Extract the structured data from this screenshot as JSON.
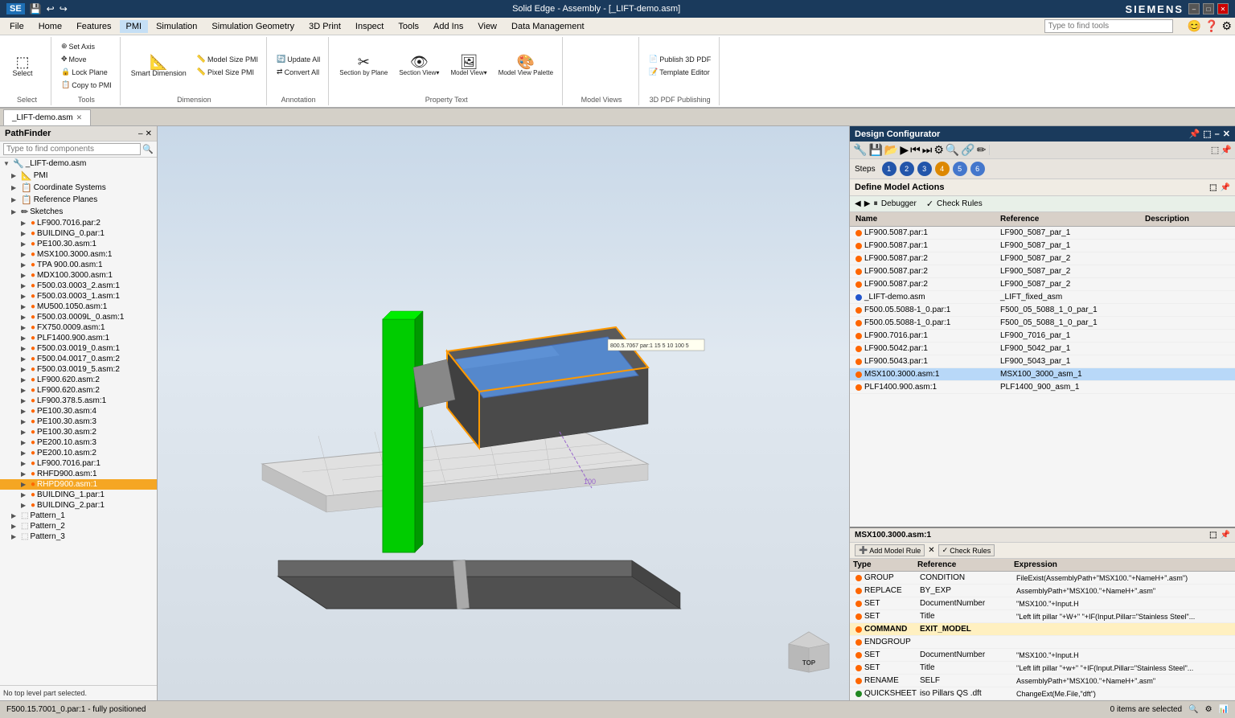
{
  "app": {
    "title": "Solid Edge - Assembly - [_LIFT-demo.asm]",
    "brand": "SIEMENS"
  },
  "titlebar": {
    "logo": "SE",
    "title": "Solid Edge - Assembly - [_LIFT-demo.asm]",
    "brand": "SIEMENS",
    "min_btn": "–",
    "max_btn": "□",
    "close_btn": "✕"
  },
  "menubar": {
    "items": [
      "File",
      "Home",
      "Features",
      "PMI",
      "Simulation",
      "Simulation Geometry",
      "3D Print",
      "Inspect",
      "Tools",
      "Add Ins",
      "View",
      "Data Management"
    ]
  },
  "ribbon": {
    "active_tab": "PMI",
    "search_placeholder": "Type to find tools",
    "groups": [
      {
        "label": "Select",
        "buttons": [
          {
            "label": "Select",
            "icon": "⬚"
          }
        ]
      },
      {
        "label": "Tools",
        "buttons": [
          {
            "label": "Set Axis",
            "icon": "⊕"
          },
          {
            "label": "Move",
            "icon": "✥"
          },
          {
            "label": "Lock Plane",
            "icon": "🔒"
          },
          {
            "label": "Copy to PMI",
            "icon": "📋"
          }
        ]
      },
      {
        "label": "Dimension",
        "buttons": [
          {
            "label": "Smart Dimension",
            "icon": "↔"
          },
          {
            "label": "Model Size PMI",
            "icon": "📐"
          },
          {
            "label": "Pixel Size PMI",
            "icon": "📏"
          }
        ]
      },
      {
        "label": "Annotation",
        "buttons": [
          {
            "label": "Update All",
            "icon": "🔄"
          },
          {
            "label": "Convert All",
            "icon": "⇄"
          }
        ]
      },
      {
        "label": "Property Text",
        "buttons": [
          {
            "label": "Section by Plane",
            "icon": "✂"
          },
          {
            "label": "Section View▾",
            "icon": "👁"
          },
          {
            "label": "Model View▾",
            "icon": "🖼"
          },
          {
            "label": "Model View Palette",
            "icon": "🎨"
          }
        ]
      },
      {
        "label": "Model Views",
        "buttons": []
      },
      {
        "label": "3D PDF Publishing",
        "buttons": [
          {
            "label": "Publish 3D PDF",
            "icon": "📄"
          },
          {
            "label": "Template Editor",
            "icon": "📝"
          }
        ]
      }
    ]
  },
  "tabbar": {
    "tabs": [
      {
        "label": "_LIFT-demo.asm",
        "active": true,
        "closeable": true
      }
    ]
  },
  "pathfinder": {
    "title": "PathFinder",
    "search_placeholder": "Type to find components",
    "tree": [
      {
        "level": 0,
        "expanded": true,
        "icon": "🔧",
        "label": "_LIFT-demo.asm",
        "type": "asm"
      },
      {
        "level": 1,
        "expanded": false,
        "icon": "📐",
        "label": "PMI",
        "type": "pmi"
      },
      {
        "level": 1,
        "expanded": false,
        "icon": "📋",
        "label": "Coordinate Systems",
        "type": "coord"
      },
      {
        "level": 1,
        "expanded": false,
        "icon": "📋",
        "label": "Reference Planes",
        "type": "ref"
      },
      {
        "level": 1,
        "expanded": false,
        "icon": "✏",
        "label": "Sketches",
        "type": "sketch"
      },
      {
        "level": 2,
        "expanded": false,
        "icon": "🟠",
        "label": "LF900.7016.par:2",
        "type": "part"
      },
      {
        "level": 2,
        "expanded": false,
        "icon": "🟠",
        "label": "BUILDING_0.par:1",
        "type": "part"
      },
      {
        "level": 2,
        "expanded": false,
        "icon": "🟠",
        "label": "PE100.30.asm:1",
        "type": "asm"
      },
      {
        "level": 2,
        "expanded": false,
        "icon": "🟠",
        "label": "MSX100.3000.asm:1",
        "type": "asm"
      },
      {
        "level": 2,
        "expanded": false,
        "icon": "🟠",
        "label": "TPA 900.00.asm:1",
        "type": "asm"
      },
      {
        "level": 2,
        "expanded": false,
        "icon": "🟠",
        "label": "MDX100.3000.asm:1",
        "type": "asm"
      },
      {
        "level": 2,
        "expanded": false,
        "icon": "🟠",
        "label": "F500.03.0003_2.asm:1",
        "type": "asm"
      },
      {
        "level": 2,
        "expanded": false,
        "icon": "🟠",
        "label": "F500.03.0003_1.asm:1",
        "type": "asm"
      },
      {
        "level": 2,
        "expanded": false,
        "icon": "🟠",
        "label": "MU500.1050.asm:1",
        "type": "asm"
      },
      {
        "level": 2,
        "expanded": false,
        "icon": "🟠",
        "label": "F500.03.0009L_0.asm:1",
        "type": "asm"
      },
      {
        "level": 2,
        "expanded": false,
        "icon": "🟠",
        "label": "FX750.0009.asm:1",
        "type": "asm"
      },
      {
        "level": 2,
        "expanded": false,
        "icon": "🟠",
        "label": "PLF1400.900.asm:1",
        "type": "asm"
      },
      {
        "level": 2,
        "expanded": false,
        "icon": "🟠",
        "label": "F500.03.0019_0.asm:1",
        "type": "asm"
      },
      {
        "level": 2,
        "expanded": false,
        "icon": "🟠",
        "label": "F500.04.0017_0.asm:2",
        "type": "asm"
      },
      {
        "level": 2,
        "expanded": false,
        "icon": "🟠",
        "label": "F500.03.0019_5.asm:2",
        "type": "asm"
      },
      {
        "level": 2,
        "expanded": false,
        "icon": "🟠",
        "label": "LF900.620.asm:2",
        "type": "asm"
      },
      {
        "level": 2,
        "expanded": false,
        "icon": "🟠",
        "label": "LF900.620.asm:2",
        "type": "asm"
      },
      {
        "level": 2,
        "expanded": false,
        "icon": "🟠",
        "label": "LF900.378.5.asm:1",
        "type": "asm"
      },
      {
        "level": 2,
        "expanded": false,
        "icon": "🟠",
        "label": "PE100.30.asm:4",
        "type": "asm"
      },
      {
        "level": 2,
        "expanded": false,
        "icon": "🟠",
        "label": "PE100.30.asm:3",
        "type": "asm"
      },
      {
        "level": 2,
        "expanded": false,
        "icon": "🟠",
        "label": "PE100.30.asm:2",
        "type": "asm"
      },
      {
        "level": 2,
        "expanded": false,
        "icon": "🟠",
        "label": "PE200.10.asm:3",
        "type": "asm"
      },
      {
        "level": 2,
        "expanded": false,
        "icon": "🟠",
        "label": "PE200.10.asm:2",
        "type": "asm"
      },
      {
        "level": 2,
        "expanded": false,
        "icon": "🟠",
        "label": "LF900.7016.par:1",
        "type": "part"
      },
      {
        "level": 2,
        "expanded": false,
        "icon": "🟠",
        "label": "RHFD900.asm:1",
        "type": "asm"
      },
      {
        "level": 2,
        "expanded": false,
        "icon": "🟠",
        "label": "RHPD900.asm:1",
        "type": "asm",
        "selected": true
      },
      {
        "level": 2,
        "expanded": false,
        "icon": "🟠",
        "label": "BUILDING_1.par:1",
        "type": "part"
      },
      {
        "level": 2,
        "expanded": false,
        "icon": "🟠",
        "label": "BUILDING_2.par:1",
        "type": "part"
      },
      {
        "level": 1,
        "expanded": false,
        "icon": "⬚",
        "label": "Pattern_1",
        "type": "pattern"
      },
      {
        "level": 1,
        "expanded": false,
        "icon": "⬚",
        "label": "Pattern_2",
        "type": "pattern"
      },
      {
        "level": 1,
        "expanded": false,
        "icon": "⬚",
        "label": "Pattern_3",
        "type": "pattern"
      }
    ]
  },
  "viewport": {
    "status_text": "No top level part selected.",
    "bottom_status": "F500.15.7001_0.par:1 - fully positioned"
  },
  "design_configurator": {
    "title": "Design Configurator",
    "steps_label": "Steps",
    "steps": [
      "1",
      "2",
      "3",
      "4",
      "5",
      "6"
    ],
    "active_step": 3,
    "warn_step": 4,
    "section_title": "Define Model Actions",
    "debugger_label": "Debugger",
    "check_rules_label": "Check Rules",
    "table_headers": [
      "Name",
      "Reference",
      "Description"
    ],
    "rows": [
      {
        "dot": "orange",
        "name": "LF900.5087.par:1",
        "reference": "LF900_5087_par_1",
        "description": ""
      },
      {
        "dot": "orange",
        "name": "LF900.5087.par:1",
        "reference": "LF900_5087_par_1",
        "description": ""
      },
      {
        "dot": "orange",
        "name": "LF900.5087.par:2",
        "reference": "LF900_5087_par_2",
        "description": ""
      },
      {
        "dot": "orange",
        "name": "LF900.5087.par:2",
        "reference": "LF900_5087_par_2",
        "description": ""
      },
      {
        "dot": "orange",
        "name": "LF900.5087.par:2",
        "reference": "LF900_5087_par_2",
        "description": ""
      },
      {
        "dot": "blue",
        "name": "_LIFT-demo.asm",
        "reference": "_LIFT_fixed_asm",
        "description": ""
      },
      {
        "dot": "orange",
        "name": "F500.05.5088-1_0.par:1",
        "reference": "F500_05_5088_1_0_par_1",
        "description": ""
      },
      {
        "dot": "orange",
        "name": "F500.05.5088-1_0.par:1",
        "reference": "F500_05_5088_1_0_par_1",
        "description": ""
      },
      {
        "dot": "orange",
        "name": "LF900.7016.par:1",
        "reference": "LF900_7016_par_1",
        "description": ""
      },
      {
        "dot": "orange",
        "name": "LF900.5042.par:1",
        "reference": "LF900_5042_par_1",
        "description": ""
      },
      {
        "dot": "orange",
        "name": "LF900.5043.par:1",
        "reference": "LF900_5043_par_1",
        "description": ""
      },
      {
        "dot": "orange",
        "name": "MSX100.3000.asm:1",
        "reference": "MSX100_3000_asm_1",
        "description": "",
        "selected": true
      },
      {
        "dot": "orange",
        "name": "PLF1400.900.asm:1",
        "reference": "PLF1400_900_asm_1",
        "description": ""
      }
    ],
    "msx_section": {
      "title": "MSX100.3000.asm:1",
      "toolbar_buttons": [
        "Add Model Rule",
        "✕",
        "Check Rules"
      ],
      "table_headers": [
        "Type",
        "Reference",
        "Expression"
      ],
      "rows": [
        {
          "dot": "orange",
          "type": "GROUP",
          "reference": "CONDITION",
          "expression": "FileExist(AssemblyPath+\"MSX100.\"+NameH+\".asm\")"
        },
        {
          "dot": "orange",
          "type": "REPLACE",
          "reference": "BY_EXP",
          "expression": "AssemblyPath+\"MSX100.\"+NameH+\".asm\""
        },
        {
          "dot": "orange",
          "type": "SET",
          "reference": "DocumentNumber",
          "expression": "\"MSX100.\"+Input.H"
        },
        {
          "dot": "orange",
          "type": "SET",
          "reference": "Title",
          "expression": "\"Left lift pillar \"+W+\" \"+IF(Input.Pillar=\"Stainless Steel\"..."
        },
        {
          "dot": "orange",
          "type": "COMMAND",
          "reference": "EXIT_MODEL",
          "expression": "",
          "highlight": true
        },
        {
          "dot": "orange",
          "type": "ENDGROUP",
          "reference": "",
          "expression": ""
        },
        {
          "dot": "orange",
          "type": "SET",
          "reference": "DocumentNumber",
          "expression": "\"MSX100.\"+Input.H"
        },
        {
          "dot": "orange",
          "type": "SET",
          "reference": "Title",
          "expression": "\"Left lift pillar \"+w+\" \"+IF(Input.Pillar=\"Stainless Steel\"..."
        },
        {
          "dot": "orange",
          "type": "RENAME",
          "reference": "SELF",
          "expression": "AssemblyPath+\"MSX100.\"+NameH+\".asm\""
        },
        {
          "dot": "green",
          "type": "QUICKSHEET",
          "reference": "iso Pillars QS .dft",
          "expression": "ChangeExt(Me.File,\"dft\")"
        }
      ]
    }
  },
  "statusbar": {
    "left": "F500.15.7001_0.par:1 - fully positioned",
    "right": "0 items are selected"
  }
}
